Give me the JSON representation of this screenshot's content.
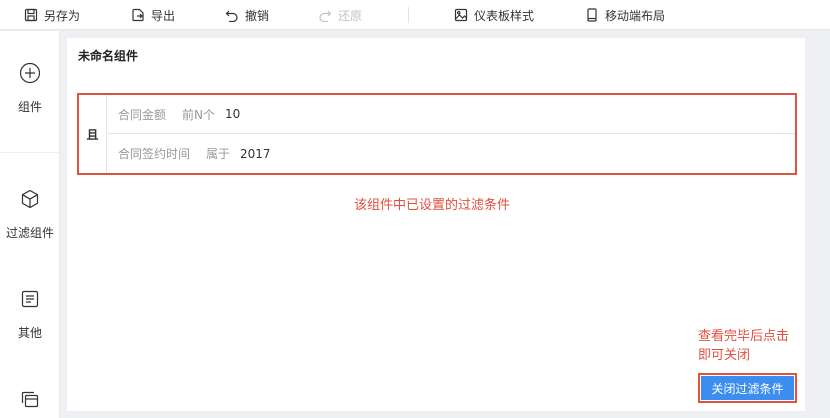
{
  "toolbar": {
    "save_as": "另存为",
    "export": "导出",
    "undo": "撤销",
    "redo": "还原",
    "dashboard_style": "仪表板样式",
    "mobile_layout": "移动端布局"
  },
  "sidebar": {
    "items": [
      {
        "label": "组件",
        "icon": "plus-circle-icon"
      },
      {
        "label": "过滤组件",
        "icon": "cube-icon"
      },
      {
        "label": "其他",
        "icon": "document-icon"
      },
      {
        "label": "",
        "icon": "layers-icon"
      }
    ]
  },
  "panel": {
    "title": "未命名组件",
    "logic_label": "且",
    "conditions": [
      {
        "field": "合同金额",
        "operator": "前N个",
        "value": "10"
      },
      {
        "field": "合同签约时间",
        "operator": "属于",
        "value": "2017"
      }
    ],
    "annotation_filters": "该组件中已设置的过滤条件",
    "annotation_close_line1": "查看完毕后点击",
    "annotation_close_line2": "即可关闭",
    "close_button_label": "关闭过滤条件"
  },
  "colors": {
    "accent": "#3c8df0",
    "highlight": "#e0513f",
    "disabled": "#bfc3c9"
  }
}
